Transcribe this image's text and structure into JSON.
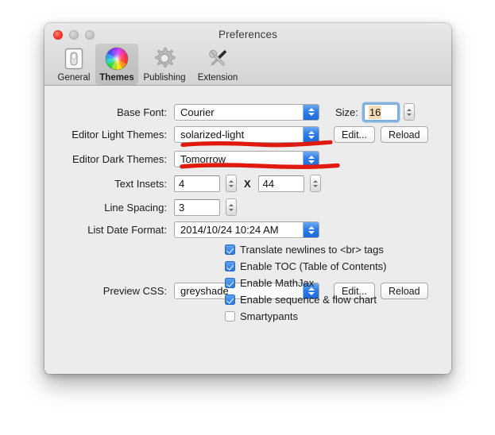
{
  "window": {
    "title": "Preferences",
    "traffic_lights": [
      "close",
      "minimize",
      "maximize"
    ]
  },
  "toolbar": {
    "tabs": [
      {
        "label": "General",
        "icon": "toggle-switch-icon",
        "selected": false
      },
      {
        "label": "Themes",
        "icon": "color-wheel-icon",
        "selected": true
      },
      {
        "label": "Publishing",
        "icon": "gear-icon",
        "selected": false
      },
      {
        "label": "Extension",
        "icon": "tools-icon",
        "selected": false
      }
    ]
  },
  "form": {
    "base_font": {
      "label": "Base Font:",
      "value": "Courier",
      "size_label": "Size:",
      "size_value": "16"
    },
    "light_themes": {
      "label": "Editor Light Themes:",
      "value": "solarized-light",
      "edit_label": "Edit...",
      "reload_label": "Reload"
    },
    "dark_themes": {
      "label": "Editor Dark Themes:",
      "value": "Tomorrow"
    },
    "text_insets": {
      "label": "Text Insets:",
      "value_x": "4",
      "separator": "X",
      "value_y": "44"
    },
    "line_spacing": {
      "label": "Line Spacing:",
      "value": "3"
    },
    "list_date_format": {
      "label": "List Date Format:",
      "value": "2014/10/24 10:24 AM"
    },
    "preview_css": {
      "label": "Preview CSS:",
      "value": "greyshade",
      "edit_label": "Edit...",
      "reload_label": "Reload"
    }
  },
  "checkboxes": [
    {
      "label": "Translate newlines to <br> tags",
      "checked": true
    },
    {
      "label": "Enable TOC (Table of Contents)",
      "checked": true
    },
    {
      "label": "Enable MathJax",
      "checked": true
    },
    {
      "label": "Enable sequence & flow chart",
      "checked": true
    },
    {
      "label": "Smartypants",
      "checked": false
    }
  ],
  "annotations": {
    "color": "#e01b10",
    "marks": [
      {
        "name": "underline-solarized-light",
        "description": "hand-drawn red underline beneath the Editor Light Themes popup"
      },
      {
        "name": "underline-tomorrow",
        "description": "hand-drawn red underline beneath the Editor Dark Themes popup"
      }
    ]
  },
  "colors": {
    "window_background": "#ececec",
    "titlebar_top": "#e8e8e8",
    "titlebar_bottom": "#d4d4d4",
    "accent_blue": "#2b7bea",
    "checkbox_blue": "#2a79e8",
    "selection_tan": "#f5dcb8",
    "annotation_red": "#e01b10",
    "page_background": "#ffffff"
  }
}
